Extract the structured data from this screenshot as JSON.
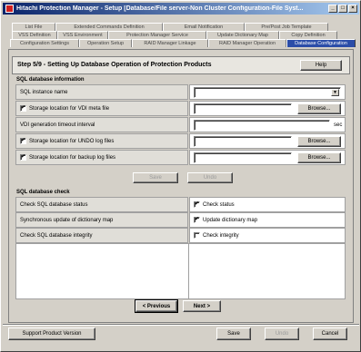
{
  "window": {
    "title": "Hitachi Protection Manager - Setup [Database/File server-Non Cluster Configuration-File Syst..."
  },
  "tabs": {
    "row1": [
      "List File",
      "Extended Commands Definition",
      "Email Notification",
      "Pre/Post Job Template"
    ],
    "row2": [
      "VSS Definition",
      "VSS Environment",
      "Protection Manager Service",
      "Update Dictionary Map",
      "Copy Definition"
    ],
    "row3": [
      "Configuration Settings",
      "Operation Setup",
      "RAID Manager Linkage",
      "RAID Manager Operation",
      "Database Configuration"
    ]
  },
  "step": {
    "title": "Step 5/9 - Setting Up Database Operation of Protection Products",
    "help": "Help"
  },
  "sql_info": {
    "title": "SQL database information",
    "instance_label": "SQL instance name",
    "instance_value": "",
    "vdi_meta_label": "Storage location for VDI meta file",
    "vdi_meta_checked": "✔",
    "vdi_timeout_label": "VDI generation timeout interval",
    "vdi_timeout_unit": "sec",
    "undo_label": "Storage location for UNDO log files",
    "undo_checked": "✔",
    "backup_label": "Storage location for backup log files",
    "backup_checked": "✔",
    "browse": "Browse...",
    "save": "Save",
    "undo": "Undo"
  },
  "sql_check": {
    "title": "SQL database check",
    "status_label": "Check SQL database status",
    "status_cb_label": "Check status",
    "status_checked": "✔",
    "sync_label": "Synchronous update of dictionary map",
    "sync_cb_label": "Update dictionary map",
    "sync_checked": "✔",
    "integrity_label": "Check SQL database integrity",
    "integrity_cb_label": "Check integrity",
    "integrity_checked": ""
  },
  "nav": {
    "previous": "< Previous",
    "next": "Next >"
  },
  "footer": {
    "support": "Support Product Version",
    "save": "Save",
    "undo": "Undo",
    "cancel": "Cancel"
  }
}
